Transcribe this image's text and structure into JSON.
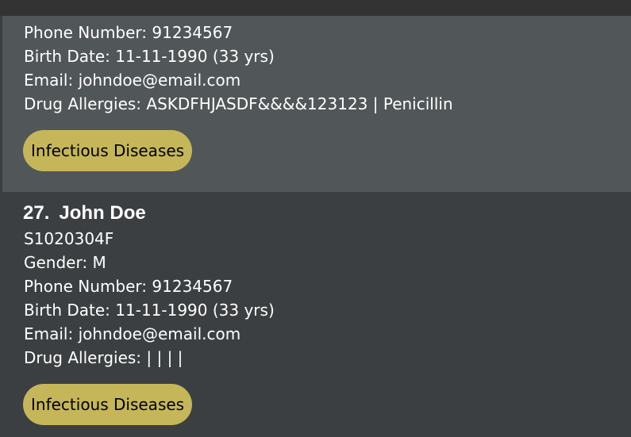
{
  "patients": [
    {
      "phone": "Phone Number: 91234567",
      "birth": "Birth Date: 11-11-1990 (33 yrs)",
      "email": "Email: johndoe@email.com",
      "allergies": "Drug Allergies: ASKDFHJASDF&&&&123123 | Penicillin",
      "tag": "Infectious Diseases"
    },
    {
      "index": "27.",
      "name": "John Doe",
      "nric": "S1020304F",
      "gender": "Gender: M",
      "phone": "Phone Number: 91234567",
      "birth": "Birth Date: 11-11-1990 (33 yrs)",
      "email": "Email: johndoe@email.com",
      "allergies": "Drug Allergies: | | | |",
      "tag": "Infectious Diseases"
    }
  ]
}
